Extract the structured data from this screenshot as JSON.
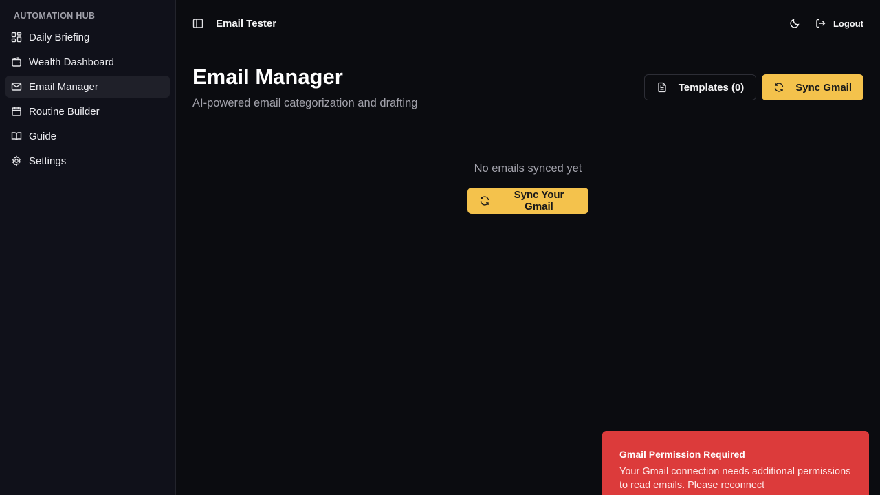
{
  "sidebar": {
    "heading": "AUTOMATION HUB",
    "items": [
      {
        "label": "Daily Briefing",
        "icon": "dashboard-grid-icon"
      },
      {
        "label": "Wealth Dashboard",
        "icon": "wallet-icon"
      },
      {
        "label": "Email Manager",
        "icon": "mail-icon",
        "active": true
      },
      {
        "label": "Routine Builder",
        "icon": "calendar-icon"
      },
      {
        "label": "Guide",
        "icon": "book-open-icon"
      },
      {
        "label": "Settings",
        "icon": "gear-icon"
      }
    ]
  },
  "topbar": {
    "title": "Email Tester",
    "logout_label": "Logout"
  },
  "page": {
    "title": "Email Manager",
    "subtitle": "AI-powered email categorization and drafting",
    "templates_label": "Templates (0)",
    "sync_label": "Sync Gmail"
  },
  "empty_state": {
    "text": "No emails synced yet",
    "button_label": "Sync Your Gmail"
  },
  "toast": {
    "title": "Gmail Permission Required",
    "body": "Your Gmail connection needs additional permissions to read emails. Please reconnect"
  },
  "colors": {
    "background": "#0b0c10",
    "sidebar": "#10111a",
    "accent": "#f4c24c",
    "toast": "#dc3b3b"
  }
}
